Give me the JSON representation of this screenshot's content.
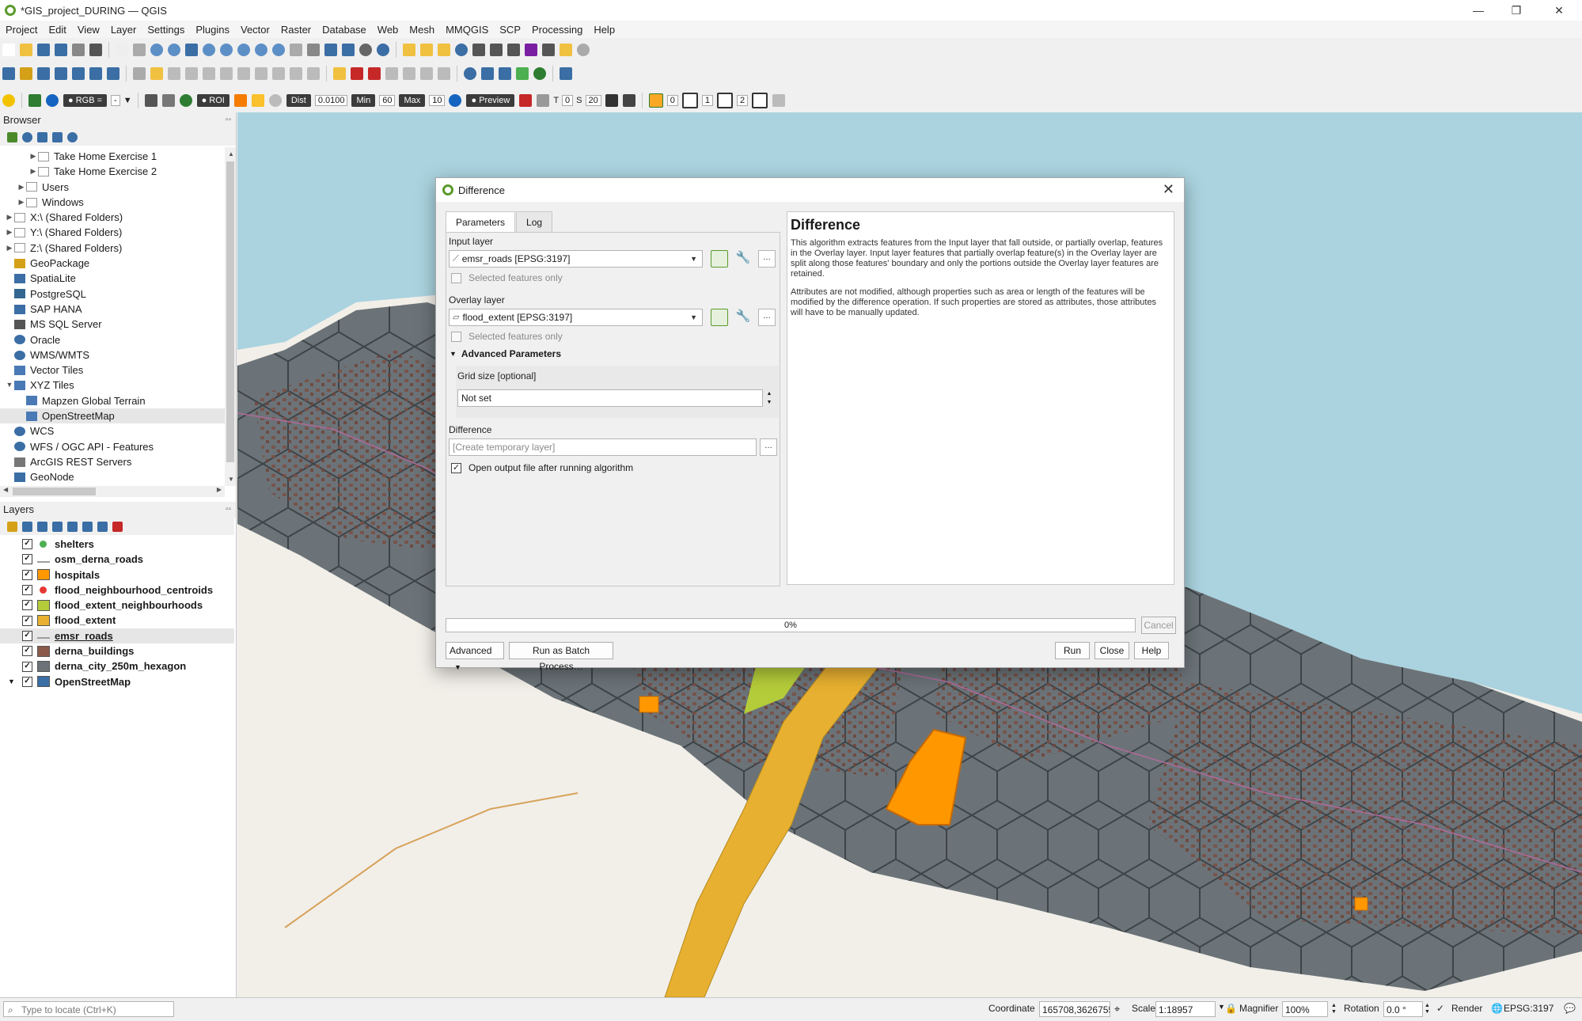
{
  "window": {
    "title": "*GIS_project_DURING — QGIS"
  },
  "menu": [
    "Project",
    "Edit",
    "View",
    "Layer",
    "Settings",
    "Plugins",
    "Vector",
    "Raster",
    "Database",
    "Web",
    "Mesh",
    "MMQGIS",
    "SCP",
    "Processing",
    "Help"
  ],
  "toolbar3": {
    "band_combo": "RGB =",
    "band_value": "-",
    "roi_label": "ROI",
    "dist_label": "Dist",
    "dist_value": "0.0100",
    "min_label": "Min",
    "min_value": "60",
    "max_label": "Max",
    "max_value": "10",
    "preview_label": "Preview",
    "t_label": "T",
    "t_value": "0",
    "s_label": "S",
    "s_value": "20",
    "spin_a": "0",
    "spin_b": "1",
    "spin_c": "2"
  },
  "browser": {
    "title": "Browser",
    "items": [
      {
        "label": "Take Home Exercise 1",
        "indent": 2
      },
      {
        "label": "Take Home Exercise 2",
        "indent": 2
      },
      {
        "label": "Users",
        "indent": 1
      },
      {
        "label": "Windows",
        "indent": 1
      },
      {
        "label": "X:\\ (Shared Folders)",
        "indent": 0
      },
      {
        "label": "Y:\\ (Shared Folders)",
        "indent": 0
      },
      {
        "label": "Z:\\ (Shared Folders)",
        "indent": 0
      },
      {
        "label": "GeoPackage",
        "indent": 0
      },
      {
        "label": "SpatiaLite",
        "indent": 0
      },
      {
        "label": "PostgreSQL",
        "indent": 0
      },
      {
        "label": "SAP HANA",
        "indent": 0
      },
      {
        "label": "MS SQL Server",
        "indent": 0
      },
      {
        "label": "Oracle",
        "indent": 0
      },
      {
        "label": "WMS/WMTS",
        "indent": 0
      },
      {
        "label": "Vector Tiles",
        "indent": 0
      },
      {
        "label": "XYZ Tiles",
        "indent": 0
      },
      {
        "label": "Mapzen Global Terrain",
        "indent": 1
      },
      {
        "label": "OpenStreetMap",
        "indent": 1
      },
      {
        "label": "WCS",
        "indent": 0
      },
      {
        "label": "WFS / OGC API - Features",
        "indent": 0
      },
      {
        "label": "ArcGIS REST Servers",
        "indent": 0
      },
      {
        "label": "GeoNode",
        "indent": 0
      }
    ]
  },
  "layers": {
    "title": "Layers",
    "items": [
      {
        "label": "shelters",
        "color": "#4caf50"
      },
      {
        "label": "osm_derna_roads",
        "color": "#9e9e9e"
      },
      {
        "label": "hospitals",
        "color": "#ff9800"
      },
      {
        "label": "flood_neighbourhood_centroids",
        "color": "#e53935"
      },
      {
        "label": "flood_extent_neighbourhoods",
        "color": "#b5cc3a"
      },
      {
        "label": "flood_extent",
        "color": "#e8b030"
      },
      {
        "label": "emsr_roads",
        "color": "#9e9e9e"
      },
      {
        "label": "derna_buildings",
        "color": "#8b5a4a"
      },
      {
        "label": "derna_city_250m_hexagon",
        "color": "#6b7378"
      },
      {
        "label": "OpenStreetMap",
        "color": "#3a6ea5"
      }
    ]
  },
  "dialog": {
    "title": "Difference",
    "tabs": [
      "Parameters",
      "Log"
    ],
    "input_layer_label": "Input layer",
    "input_layer_value": "emsr_roads [EPSG:3197]",
    "selected_only": "Selected features only",
    "overlay_layer_label": "Overlay layer",
    "overlay_layer_value": "flood_extent [EPSG:3197]",
    "advanced_params": "Advanced Parameters",
    "grid_size_label": "Grid size [optional]",
    "grid_size_value": "Not set",
    "difference_label": "Difference",
    "difference_placeholder": "[Create temporary layer]",
    "open_output": "Open output file after running algorithm",
    "help_title": "Difference",
    "help_p1": "This algorithm extracts features from the Input layer that fall outside, or partially overlap, features in the Overlay layer. Input layer features that partially overlap feature(s) in the Overlay layer are split along those features' boundary and only the portions outside the Overlay layer features are retained.",
    "help_p2": "Attributes are not modified, although properties such as area or length of the features will be modified by the difference operation. If such properties are stored as attributes, those attributes will have to be manually updated.",
    "progress": 0,
    "progress_text": "0%",
    "cancel": "Cancel",
    "advanced_btn": "Advanced",
    "batch_btn": "Run as Batch Process…",
    "run": "Run",
    "close": "Close",
    "help": "Help"
  },
  "status": {
    "locate_placeholder": "Type to locate (Ctrl+K)",
    "coordinate_label": "Coordinate",
    "coordinate_value": "165708,3626755",
    "scale_label": "Scale",
    "scale_value": "1:18957",
    "magnifier_label": "Magnifier",
    "magnifier_value": "100%",
    "rotation_label": "Rotation",
    "rotation_value": "0.0 °",
    "render_label": "Render",
    "crs": "EPSG:3197"
  },
  "colors": {
    "sea": "#aad3df",
    "land": "#f2efe9",
    "hexagon": "#6b7378",
    "flood": "#e8b030",
    "flood_neighbourhood": "#b5cc3a",
    "hospital": "#ff9800",
    "qgis_green": "#5a9a2b"
  },
  "icons": {
    "titlebar": "qgis-logo-icon",
    "minimize": "minimize-icon",
    "maximize": "maximize-icon",
    "close": "close-icon",
    "locate": "search-icon",
    "render": "checkmark-icon",
    "crs": "globe-icon",
    "lock": "lock-icon",
    "messages": "message-icon"
  }
}
